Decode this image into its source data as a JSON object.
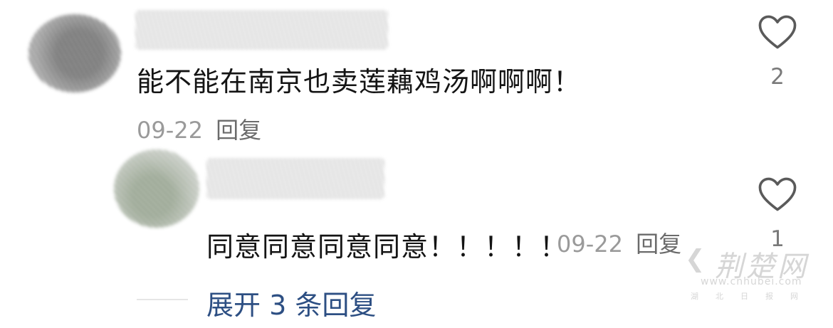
{
  "comments": [
    {
      "text": "能不能在南京也卖莲藕鸡汤啊啊啊！",
      "date": "09-22",
      "reply_label": "回复",
      "like_count": "2",
      "like_icon": "heart-outline-icon"
    },
    {
      "text": "同意同意同意同意！！！！！",
      "date": "09-22",
      "reply_label": "回复",
      "like_count": "1",
      "like_icon": "heart-outline-icon"
    }
  ],
  "expand_replies_label": "展开 3 条回复",
  "watermark": {
    "name": "荆楚网",
    "url": "www.cnhubei.com",
    "sub": "湖北日报网"
  },
  "colors": {
    "text": "#141414",
    "meta": "#9a9a9a",
    "link": "#2d4f83",
    "icon": "#5a5a5a"
  }
}
